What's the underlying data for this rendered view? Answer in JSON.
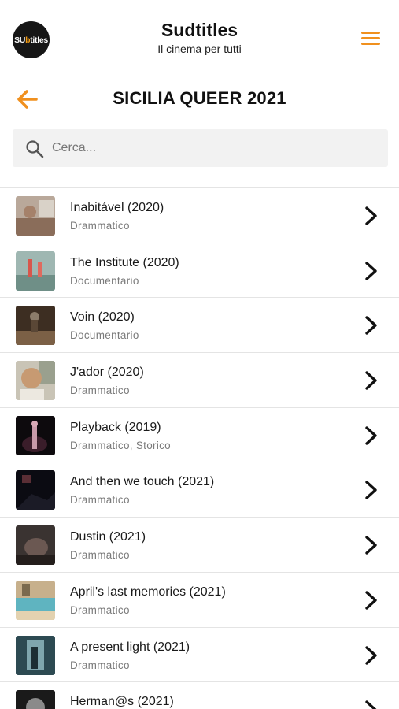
{
  "header": {
    "logo_text": "SU",
    "logo_accent": "b",
    "logo_tail": "titles",
    "title": "Sudtitles",
    "subtitle": "Il cinema per tutti",
    "menu_icon": "hamburger-menu-icon"
  },
  "page": {
    "title": "SICILIA QUEER 2021",
    "back_icon": "arrow-left-icon"
  },
  "search": {
    "placeholder": "Cerca...",
    "value": ""
  },
  "colors": {
    "accent": "#f0901e",
    "text": "#111111",
    "muted": "#7a7a7a",
    "search_bg": "#f2f2f2",
    "divider": "#e4e4e4"
  },
  "films": [
    {
      "title": "Inabitável (2020)",
      "genre": "Drammatico"
    },
    {
      "title": "The Institute (2020)",
      "genre": "Documentario"
    },
    {
      "title": "Voin (2020)",
      "genre": "Documentario"
    },
    {
      "title": "J'ador (2020)",
      "genre": "Drammatico"
    },
    {
      "title": "Playback (2019)",
      "genre": "Drammatico, Storico"
    },
    {
      "title": "And then we touch (2021)",
      "genre": "Drammatico"
    },
    {
      "title": "Dustin (2021)",
      "genre": "Drammatico"
    },
    {
      "title": "April's last memories (2021)",
      "genre": "Drammatico"
    },
    {
      "title": "A present light (2021)",
      "genre": "Drammatico"
    },
    {
      "title": "Herman@s (2021)",
      "genre": ""
    }
  ]
}
